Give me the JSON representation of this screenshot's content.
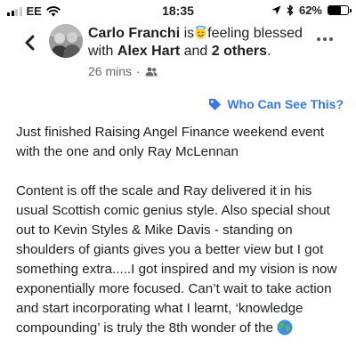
{
  "status_bar": {
    "carrier": "EE",
    "time": "18:35",
    "battery_percent": "62%",
    "battery_level": 0.62,
    "signal_bars_active": 2,
    "signal_bars_total": 4
  },
  "header": {
    "author": "Carlo Franchi",
    "is_text": "is",
    "feeling_text": "feeling blessed",
    "with_text": "with",
    "tagged_person": "Alex Hart",
    "and_text": "and",
    "others": "2 others",
    "period": ".",
    "time_ago": "26 mins",
    "separator": "·",
    "audience_icon": "friends-icon",
    "emoji_icon": "smiling-face-with-halo-icon",
    "back_icon": "chevron-left-icon",
    "more_icon": "more-dots-icon"
  },
  "privacy_link": {
    "label": "Who Can See This?",
    "icon": "tag-icon",
    "color": "#3578e5"
  },
  "post": {
    "paragraph_1": "Just finished Raising Angel Finance weekend event with the one and only Ray McLennan",
    "paragraph_2": "Content is off the scale and Ray delivered it in his usual Scottish comic genius style. Also special shout out to Kevin Styles & Mike Davis - standing on shoulders of giants gives you a better view but I got something extra.....I got inspired and my vision is now exponentially more focused. Can’t wait to take action and start incorporating what I learnt, ‘knowledge compounding’ is truly the 8th wonder of the",
    "trailing_emoji_icon": "globe-icon"
  },
  "colors": {
    "link_blue": "#3578e5",
    "meta_gray": "#65676b",
    "text": "#1c1e21"
  }
}
